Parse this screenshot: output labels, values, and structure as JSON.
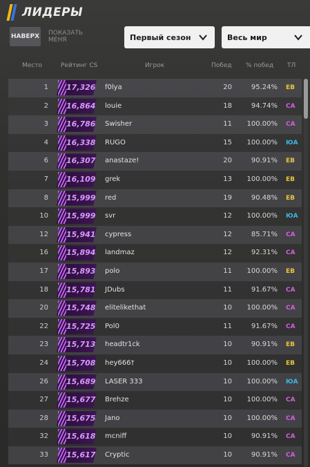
{
  "title": "ЛИДЕРЫ",
  "buttons": {
    "top": "НАВЕРХ",
    "show_me": "ПОКАЗАТЬ МЕНЯ"
  },
  "filters": {
    "season": "Первый сезон",
    "region": "Весь мир"
  },
  "headers": {
    "rank": "Место",
    "rating": "Рейтинг CS",
    "player": "Игрок",
    "wins": "Побед",
    "winpct": "% побед",
    "region": "ТЛ"
  },
  "colors": {
    "EB": "#e8c53a",
    "CA": "#d65ee0",
    "ЮА": "#3fb6e6"
  },
  "rows": [
    {
      "rank": "1",
      "rating": "17,326",
      "player": "f0lya",
      "wins": "20",
      "pct": "95.24%",
      "region": "EB"
    },
    {
      "rank": "2",
      "rating": "16,864",
      "player": "louie",
      "wins": "18",
      "pct": "94.74%",
      "region": "CA"
    },
    {
      "rank": "3",
      "rating": "16,786",
      "player": "Swisher",
      "wins": "11",
      "pct": "100.00%",
      "region": "CA"
    },
    {
      "rank": "4",
      "rating": "16,338",
      "player": "RUGO",
      "wins": "15",
      "pct": "100.00%",
      "region": "ЮА"
    },
    {
      "rank": "6",
      "rating": "16,307",
      "player": "anastaze!",
      "wins": "20",
      "pct": "90.91%",
      "region": "EB"
    },
    {
      "rank": "7",
      "rating": "16,109",
      "player": "grek",
      "wins": "13",
      "pct": "100.00%",
      "region": "EB"
    },
    {
      "rank": "8",
      "rating": "15,999",
      "player": "red",
      "wins": "19",
      "pct": "90.48%",
      "region": "EB"
    },
    {
      "rank": "10",
      "rating": "15,999",
      "player": "svr",
      "wins": "12",
      "pct": "100.00%",
      "region": "ЮА"
    },
    {
      "rank": "12",
      "rating": "15,941",
      "player": "cypress",
      "wins": "12",
      "pct": "85.71%",
      "region": "CA"
    },
    {
      "rank": "16",
      "rating": "15,894",
      "player": "landmaz",
      "wins": "12",
      "pct": "92.31%",
      "region": "CA"
    },
    {
      "rank": "17",
      "rating": "15,893",
      "player": "polo",
      "wins": "11",
      "pct": "100.00%",
      "region": "EB"
    },
    {
      "rank": "18",
      "rating": "15,781",
      "player": "JDubs",
      "wins": "11",
      "pct": "91.67%",
      "region": "CA"
    },
    {
      "rank": "20",
      "rating": "15,748",
      "player": "elitelikethat",
      "wins": "10",
      "pct": "100.00%",
      "region": "CA"
    },
    {
      "rank": "22",
      "rating": "15,725",
      "player": "Pol0",
      "wins": "11",
      "pct": "91.67%",
      "region": "CA"
    },
    {
      "rank": "23",
      "rating": "15,713",
      "player": "headtr1ck",
      "wins": "10",
      "pct": "90.91%",
      "region": "EB"
    },
    {
      "rank": "24",
      "rating": "15,708",
      "player": "hey666†",
      "wins": "10",
      "pct": "100.00%",
      "region": "EB"
    },
    {
      "rank": "26",
      "rating": "15,689",
      "player": "LASER 333",
      "wins": "10",
      "pct": "100.00%",
      "region": "ЮА"
    },
    {
      "rank": "27",
      "rating": "15,677",
      "player": "Brehze",
      "wins": "10",
      "pct": "100.00%",
      "region": "CA"
    },
    {
      "rank": "28",
      "rating": "15,675",
      "player": "Jano",
      "wins": "10",
      "pct": "100.00%",
      "region": "CA"
    },
    {
      "rank": "32",
      "rating": "15,618",
      "player": "mcniff",
      "wins": "10",
      "pct": "90.91%",
      "region": "CA"
    },
    {
      "rank": "33",
      "rating": "15,617",
      "player": "Cryptic",
      "wins": "10",
      "pct": "90.91%",
      "region": "CA"
    }
  ]
}
